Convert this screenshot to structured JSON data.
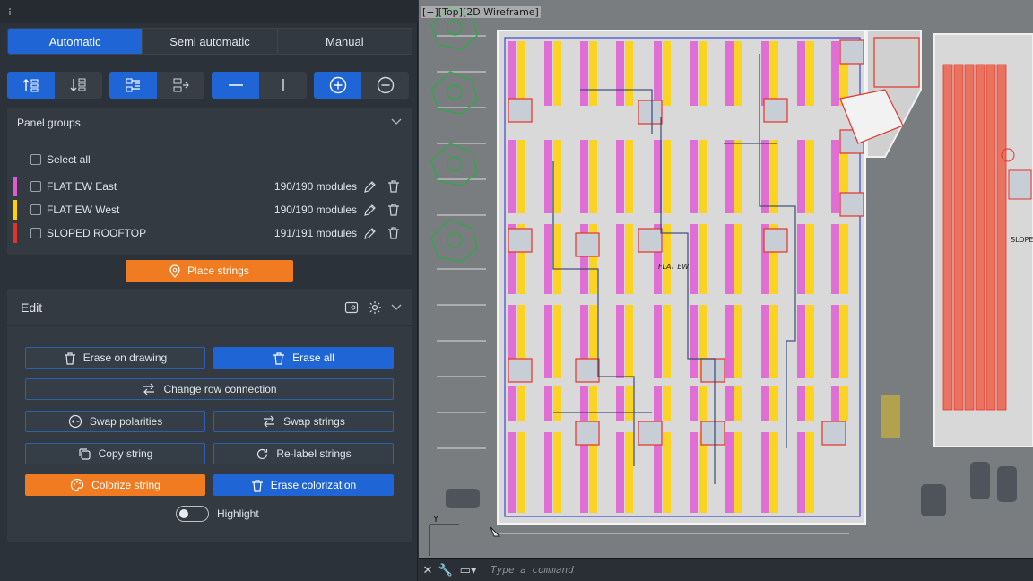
{
  "tabs": [
    "Automatic",
    "Semi automatic",
    "Manual"
  ],
  "active_tab": 0,
  "panel_groups": {
    "title": "Panel groups",
    "select_all": "Select all",
    "groups": [
      {
        "name": "FLAT EW East",
        "count": "190/190 modules",
        "color": "#e05ad2"
      },
      {
        "name": "FLAT EW West",
        "count": "190/190 modules",
        "color": "#ffd200"
      },
      {
        "name": "SLOPED ROOFTOP",
        "count": "191/191 modules",
        "color": "#e5332a"
      }
    ]
  },
  "place_strings": "Place strings",
  "edit": {
    "title": "Edit",
    "erase_on_drawing": "Erase on drawing",
    "erase_all": "Erase all",
    "change_row_connection": "Change row connection",
    "swap_polarities": "Swap polarities",
    "swap_strings": "Swap strings",
    "copy_string": "Copy string",
    "relabel_strings": "Re-label strings",
    "colorize_string": "Colorize string",
    "erase_colorization": "Erase colorization",
    "highlight": "Highlight"
  },
  "viewport": {
    "label": "[−][Top][2D Wireframe]",
    "center_label": "FLAT EW",
    "right_label": "SLOPE"
  },
  "command": {
    "placeholder": "Type a command"
  },
  "colors": {
    "accent_blue": "#1f65d6",
    "accent_orange": "#f17b21",
    "east_magenta": "#e05ad2",
    "west_yellow": "#ffd200",
    "sloped_red": "#e5332a"
  }
}
